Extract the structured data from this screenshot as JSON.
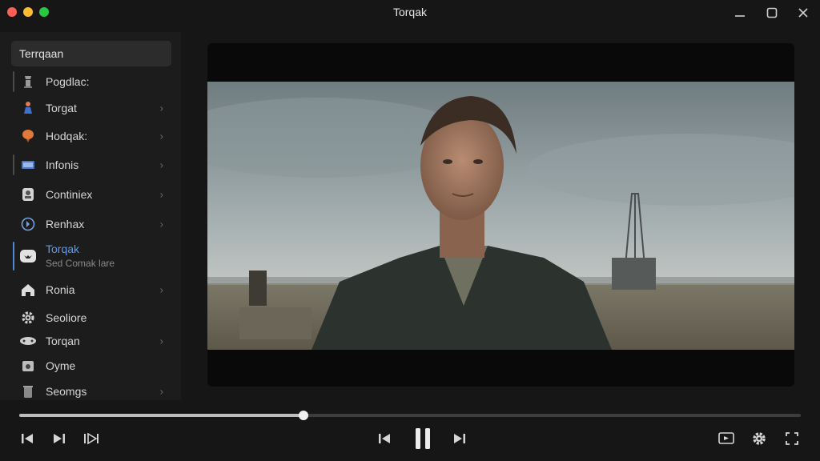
{
  "window": {
    "title": "Torqak"
  },
  "sidebar": {
    "search_value": "Terrqaan",
    "items": [
      {
        "label": "Pogdlac:",
        "icon": "tower-icon",
        "chevron": false
      },
      {
        "label": "Torgat",
        "icon": "figure-icon",
        "chevron": true
      },
      {
        "label": "Hodqak:",
        "icon": "balloon-icon",
        "chevron": true
      },
      {
        "label": "Infonis",
        "icon": "film-icon",
        "chevron": true
      },
      {
        "label": "Continiex",
        "icon": "portrait-icon",
        "chevron": true
      },
      {
        "label": "Renhax",
        "icon": "compass-icon",
        "chevron": true
      },
      {
        "label": "Torqak",
        "sublabel": "Sed Comak lare",
        "icon": "controller-icon",
        "chevron": false,
        "active": true
      },
      {
        "label": "Ronia",
        "icon": "home-icon",
        "chevron": true
      },
      {
        "label": "Seoliore",
        "icon": "gear-icon",
        "chevron": false
      },
      {
        "label": "Torqan",
        "icon": "gamepad-icon",
        "chevron": true
      },
      {
        "label": "Oyme",
        "icon": "camera-icon",
        "chevron": false
      },
      {
        "label": "Seomgs",
        "icon": "trash-icon",
        "chevron": true
      }
    ]
  },
  "player": {
    "progress": 0.364,
    "controls": {
      "left": [
        "skip-start-icon",
        "step-forward-icon",
        "next-icon"
      ],
      "center": [
        "previous-icon",
        "pause-icon",
        "next-track-icon"
      ],
      "right": [
        "cast-icon",
        "settings-icon",
        "fullscreen-icon"
      ]
    }
  },
  "colors": {
    "accent": "#5b9cf0",
    "background": "#161616",
    "sidebar": "#1c1c1c"
  }
}
